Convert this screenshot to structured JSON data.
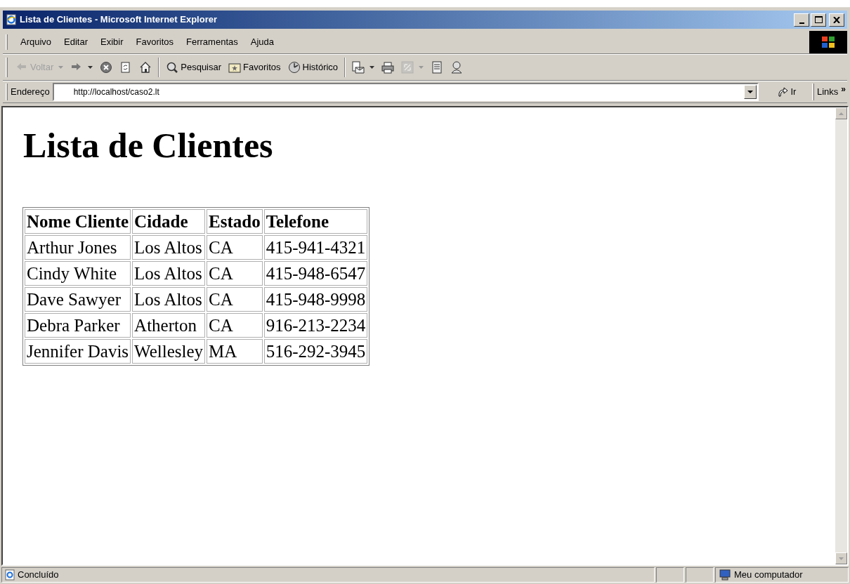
{
  "window": {
    "title": "Lista de Clientes - Microsoft Internet Explorer"
  },
  "menu": [
    "Arquivo",
    "Editar",
    "Exibir",
    "Favoritos",
    "Ferramentas",
    "Ajuda"
  ],
  "toolbar": [
    {
      "label": "Voltar",
      "disabled": true,
      "dropdown": true
    },
    {
      "disabled": false,
      "dropdown": true
    },
    {
      "disabled": false,
      "dropdown": false
    },
    {
      "disabled": false,
      "dropdown": false
    },
    {
      "disabled": false,
      "dropdown": false
    },
    {
      "label": "Pesquisar",
      "disabled": false,
      "dropdown": false
    },
    {
      "label": "Favoritos",
      "disabled": false,
      "dropdown": false
    },
    {
      "label": "Histórico",
      "disabled": false,
      "dropdown": false
    },
    {
      "disabled": false,
      "dropdown": true
    },
    {
      "disabled": false,
      "dropdown": false
    },
    {
      "disabled": true,
      "dropdown": true
    },
    {
      "disabled": false,
      "dropdown": false
    },
    {
      "disabled": false,
      "dropdown": false
    }
  ],
  "address_bar": {
    "label": "Endereço",
    "value": "http://localhost/caso2.lt",
    "go": "Ir",
    "links": "Links",
    "links_chevron": "»"
  },
  "page": {
    "heading": "Lista de Clientes",
    "table": {
      "columns": [
        "Nome Cliente",
        "Cidade",
        "Estado",
        "Telefone"
      ],
      "rows": [
        [
          "Arthur Jones",
          "Los Altos",
          "CA",
          "415-941-4321"
        ],
        [
          "Cindy White",
          "Los Altos",
          "CA",
          "415-948-6547"
        ],
        [
          "Dave Sawyer",
          "Los Altos",
          "CA",
          "415-948-9998"
        ],
        [
          "Debra Parker",
          "Atherton",
          "CA",
          "916-213-2234"
        ],
        [
          "Jennifer Davis",
          "Wellesley",
          "MA",
          "516-292-3945"
        ]
      ]
    }
  },
  "status_bar": {
    "text": "Concluído",
    "zone": "Meu computador"
  }
}
